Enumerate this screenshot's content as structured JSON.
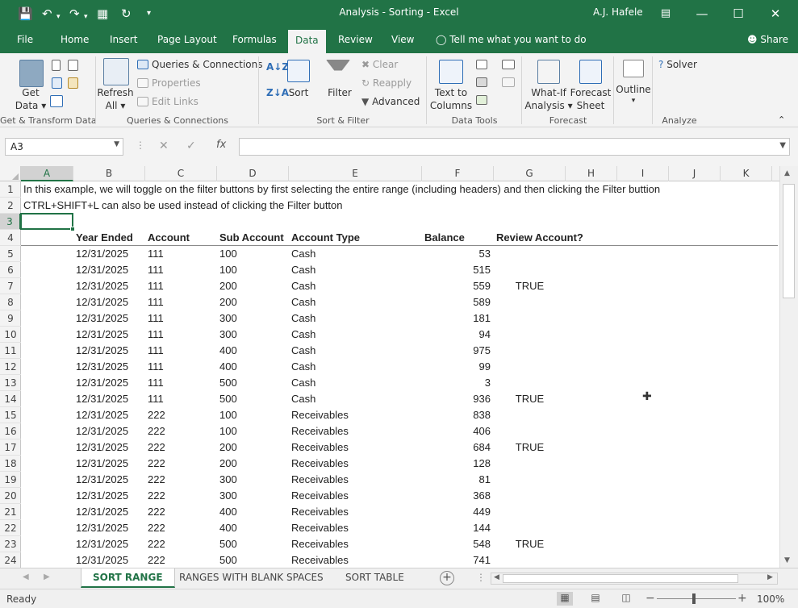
{
  "titlebar": {
    "title": "Analysis - Sorting  -  Excel",
    "user": "A.J. Hafele"
  },
  "tabs": {
    "file": "File",
    "home": "Home",
    "insert": "Insert",
    "page_layout": "Page Layout",
    "formulas": "Formulas",
    "data": "Data",
    "review": "Review",
    "view": "View",
    "tell_me": "Tell me what you want to do",
    "share": "Share"
  },
  "ribbon": {
    "get_data": "Get",
    "get_data_2": "Data",
    "queries_connections": "Queries & Connections",
    "properties": "Properties",
    "edit_links": "Edit Links",
    "refresh": "Refresh",
    "refresh_all": "All",
    "sort": "Sort",
    "filter": "Filter",
    "clear": "Clear",
    "reapply": "Reapply",
    "advanced": "Advanced",
    "text_to": "Text to",
    "columns": "Columns",
    "what_if": "What-If",
    "analysis": "Analysis",
    "forecast": "Forecast",
    "sheet": "Sheet",
    "outline": "Outline",
    "solver": "Solver",
    "groups": {
      "get_transform": "Get & Transform Data",
      "queries": "Queries & Connections",
      "sort_filter": "Sort & Filter",
      "data_tools": "Data Tools",
      "forecast": "Forecast",
      "analyze": "Analyze"
    }
  },
  "formula_bar": {
    "name_box": "A3",
    "formula": ""
  },
  "columns": [
    "A",
    "B",
    "C",
    "D",
    "E",
    "F",
    "G",
    "H",
    "I",
    "J",
    "K"
  ],
  "rows": [
    {
      "n": "1",
      "a": "In this example, we will toggle on the filter buttons by first selecting the entire range (including headers) and then clicking the Filter buttion"
    },
    {
      "n": "2",
      "a": "CTRL+SHIFT+L can also be used instead of clicking the Filter button"
    },
    {
      "n": "3",
      "a": ""
    },
    {
      "n": "4",
      "b": "Year Ended",
      "c": "Account",
      "d": "Sub Account",
      "e": "Account Type",
      "f": "Balance",
      "g": "Review Account?"
    },
    {
      "n": "5",
      "b": "12/31/2025",
      "c": "111",
      "d": "100",
      "e": "Cash",
      "f": "53",
      "g": ""
    },
    {
      "n": "6",
      "b": "12/31/2025",
      "c": "111",
      "d": "100",
      "e": "Cash",
      "f": "515",
      "g": ""
    },
    {
      "n": "7",
      "b": "12/31/2025",
      "c": "111",
      "d": "200",
      "e": "Cash",
      "f": "559",
      "g": "TRUE"
    },
    {
      "n": "8",
      "b": "12/31/2025",
      "c": "111",
      "d": "200",
      "e": "Cash",
      "f": "589",
      "g": ""
    },
    {
      "n": "9",
      "b": "12/31/2025",
      "c": "111",
      "d": "300",
      "e": "Cash",
      "f": "181",
      "g": ""
    },
    {
      "n": "10",
      "b": "12/31/2025",
      "c": "111",
      "d": "300",
      "e": "Cash",
      "f": "94",
      "g": ""
    },
    {
      "n": "11",
      "b": "12/31/2025",
      "c": "111",
      "d": "400",
      "e": "Cash",
      "f": "975",
      "g": ""
    },
    {
      "n": "12",
      "b": "12/31/2025",
      "c": "111",
      "d": "400",
      "e": "Cash",
      "f": "99",
      "g": ""
    },
    {
      "n": "13",
      "b": "12/31/2025",
      "c": "111",
      "d": "500",
      "e": "Cash",
      "f": "3",
      "g": ""
    },
    {
      "n": "14",
      "b": "12/31/2025",
      "c": "111",
      "d": "500",
      "e": "Cash",
      "f": "936",
      "g": "TRUE"
    },
    {
      "n": "15",
      "b": "12/31/2025",
      "c": "222",
      "d": "100",
      "e": "Receivables",
      "f": "838",
      "g": ""
    },
    {
      "n": "16",
      "b": "12/31/2025",
      "c": "222",
      "d": "100",
      "e": "Receivables",
      "f": "406",
      "g": ""
    },
    {
      "n": "17",
      "b": "12/31/2025",
      "c": "222",
      "d": "200",
      "e": "Receivables",
      "f": "684",
      "g": "TRUE"
    },
    {
      "n": "18",
      "b": "12/31/2025",
      "c": "222",
      "d": "200",
      "e": "Receivables",
      "f": "128",
      "g": ""
    },
    {
      "n": "19",
      "b": "12/31/2025",
      "c": "222",
      "d": "300",
      "e": "Receivables",
      "f": "81",
      "g": ""
    },
    {
      "n": "20",
      "b": "12/31/2025",
      "c": "222",
      "d": "300",
      "e": "Receivables",
      "f": "368",
      "g": ""
    },
    {
      "n": "21",
      "b": "12/31/2025",
      "c": "222",
      "d": "400",
      "e": "Receivables",
      "f": "449",
      "g": ""
    },
    {
      "n": "22",
      "b": "12/31/2025",
      "c": "222",
      "d": "400",
      "e": "Receivables",
      "f": "144",
      "g": ""
    },
    {
      "n": "23",
      "b": "12/31/2025",
      "c": "222",
      "d": "500",
      "e": "Receivables",
      "f": "548",
      "g": "TRUE"
    },
    {
      "n": "24",
      "b": "12/31/2025",
      "c": "222",
      "d": "500",
      "e": "Receivables",
      "f": "741",
      "g": ""
    }
  ],
  "sheet_tabs": [
    "SORT RANGE",
    "RANGES WITH BLANK SPACES",
    "SORT TABLE"
  ],
  "active_sheet": "SORT RANGE",
  "status": {
    "ready": "Ready",
    "zoom": "100%"
  },
  "colors": {
    "accent": "#217346"
  },
  "icons": {
    "save": "save-icon",
    "undo": "undo-icon",
    "redo": "redo-icon",
    "filter": "filter-icon",
    "sort": "sort-icon"
  }
}
